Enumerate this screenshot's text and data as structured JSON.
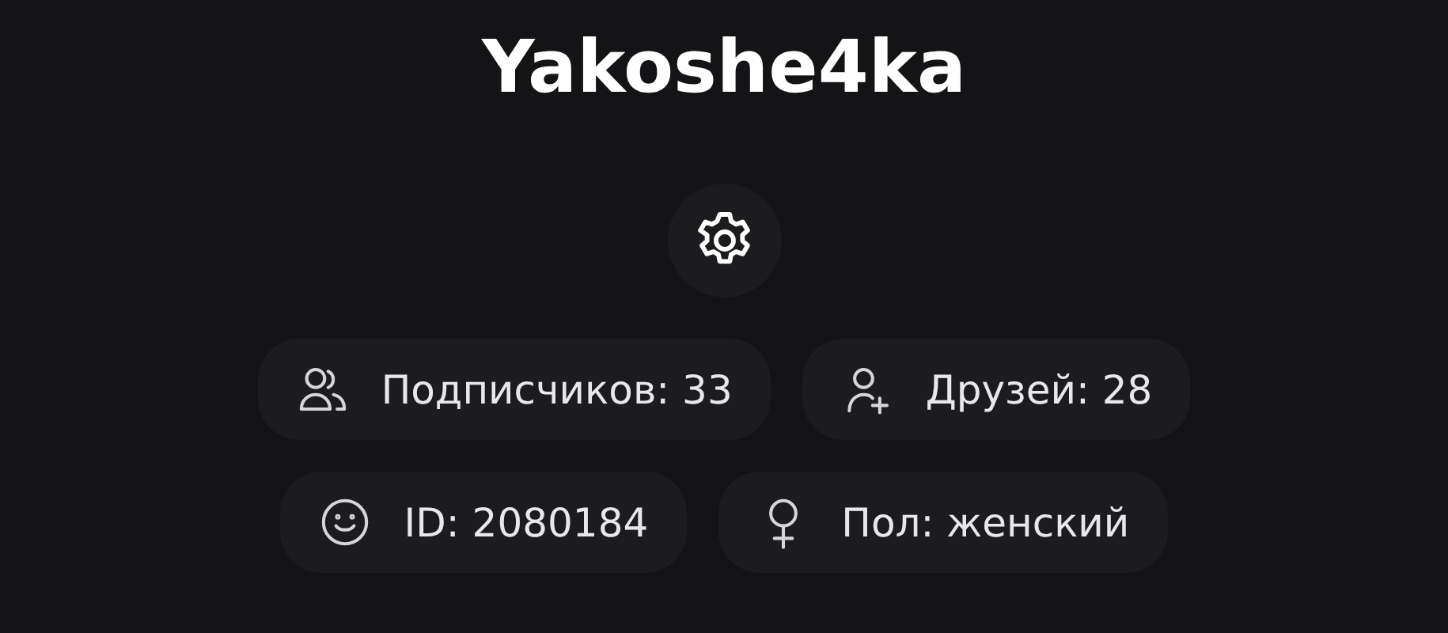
{
  "profile": {
    "username": "Yakoshe4ka"
  },
  "stats_rows": [
    {
      "items": [
        {
          "kind": "followers",
          "label": "Подписчиков: 33"
        },
        {
          "kind": "friends",
          "label": "Друзей: 28"
        }
      ]
    },
    {
      "items": [
        {
          "kind": "id",
          "label": "ID: 2080184"
        },
        {
          "kind": "gender",
          "label": "Пол: женский"
        }
      ]
    }
  ]
}
